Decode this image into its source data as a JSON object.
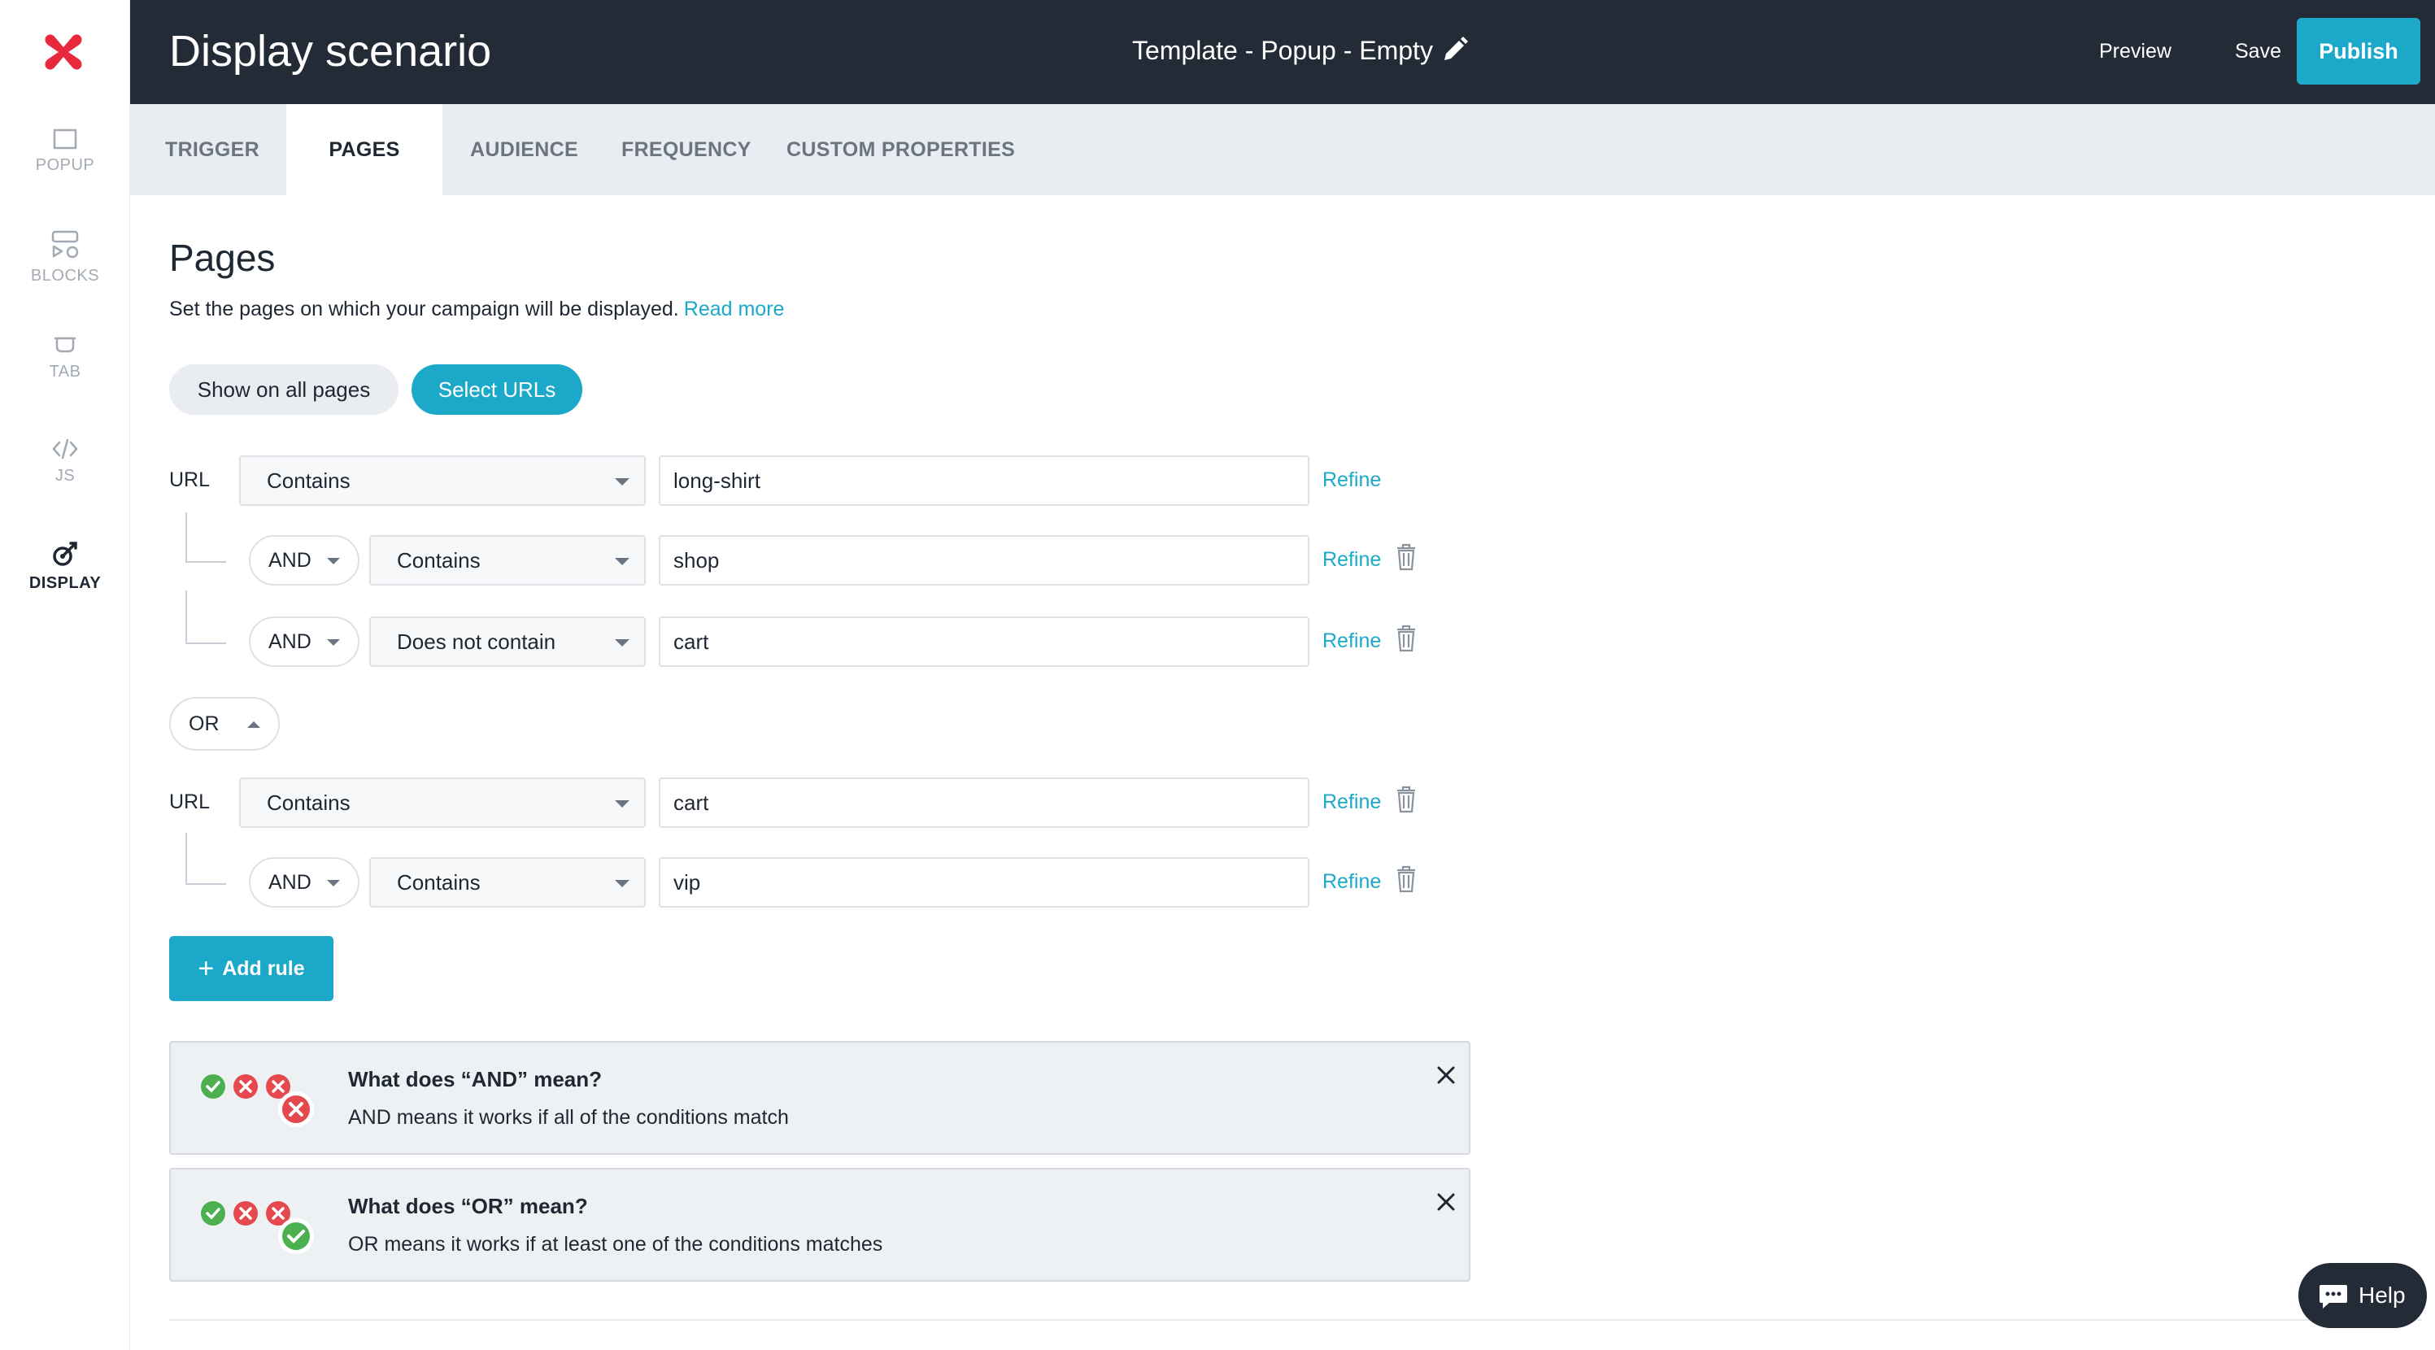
{
  "sidebar": {
    "items": [
      {
        "label": "POPUP"
      },
      {
        "label": "BLOCKS"
      },
      {
        "label": "TAB"
      },
      {
        "label": "JS"
      },
      {
        "label": "DISPLAY"
      }
    ],
    "active": "DISPLAY"
  },
  "header": {
    "title": "Display scenario",
    "template_name": "Template - Popup - Empty",
    "preview_label": "Preview",
    "save_label": "Save",
    "publish_label": "Publish"
  },
  "tabs": [
    {
      "label": "TRIGGER"
    },
    {
      "label": "PAGES"
    },
    {
      "label": "AUDIENCE"
    },
    {
      "label": "FREQUENCY"
    },
    {
      "label": "CUSTOM PROPERTIES"
    }
  ],
  "active_tab": "PAGES",
  "pages": {
    "title": "Pages",
    "description": "Set the pages on which your campaign will be displayed.",
    "read_more": "Read more",
    "toggle": {
      "show_all": "Show on all pages",
      "select_urls": "Select URLs",
      "selected": "Select URLs"
    }
  },
  "rule_groups": [
    {
      "url_label": "URL",
      "condition": "Contains",
      "value": "long-shirt",
      "refine": "Refine",
      "sub_rules": [
        {
          "operator": "AND",
          "condition": "Contains",
          "value": "shop",
          "refine": "Refine"
        },
        {
          "operator": "AND",
          "condition": "Does not contain",
          "value": "cart",
          "refine": "Refine"
        }
      ]
    },
    {
      "url_label": "URL",
      "condition": "Contains",
      "value": "cart",
      "refine": "Refine",
      "sub_rules": [
        {
          "operator": "AND",
          "condition": "Contains",
          "value": "vip",
          "refine": "Refine"
        }
      ]
    }
  ],
  "group_operator": "OR",
  "add_rule_label": "Add rule",
  "info_boxes": [
    {
      "title": "What does “AND” mean?",
      "text": "AND means it works if all of the conditions match",
      "result": "fail"
    },
    {
      "title": "What does “OR” mean?",
      "text": "OR means it works if at least one of the conditions matches",
      "result": "pass"
    }
  ],
  "help_label": "Help",
  "colors": {
    "header_bg": "#232b37",
    "accent": "#1ca9c9",
    "logo": "#e8283c",
    "success": "#4caf50",
    "error": "#e5484d"
  }
}
